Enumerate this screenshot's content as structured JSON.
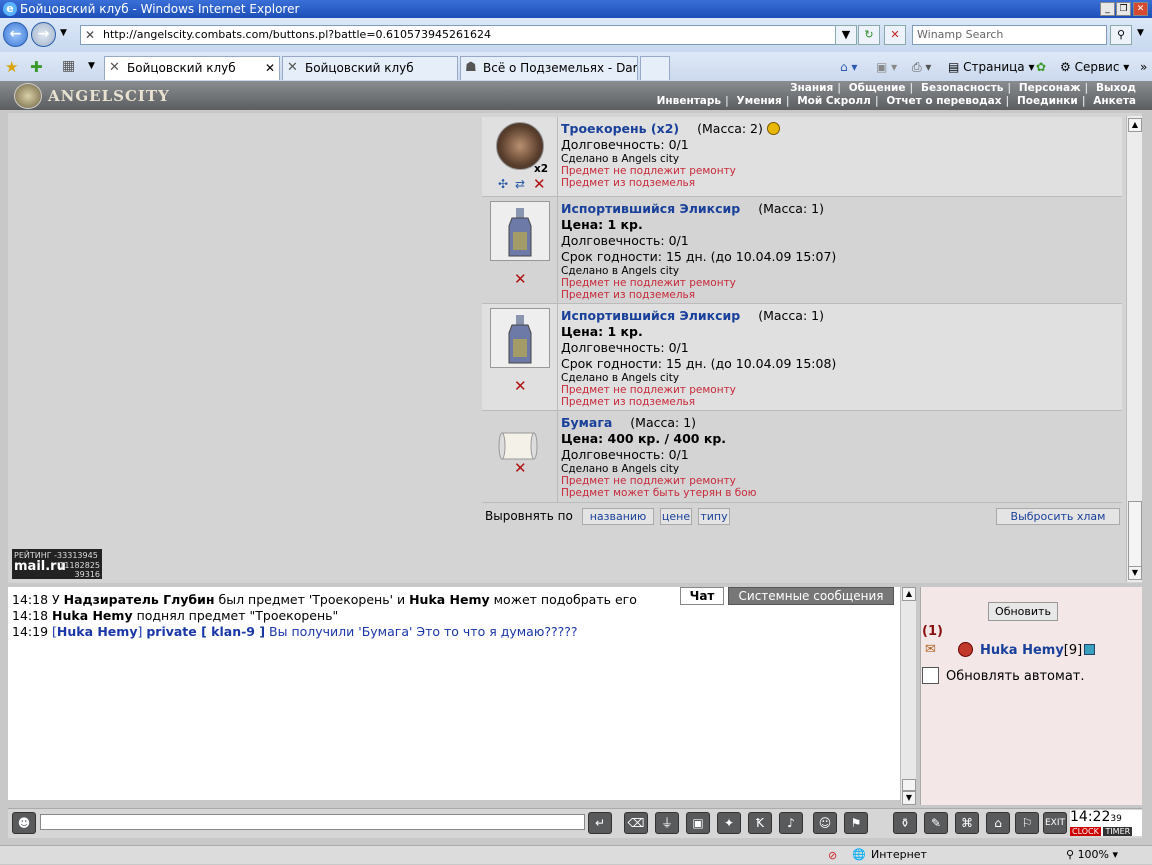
{
  "window": {
    "title": "Бойцовский клуб - Windows Internet Explorer"
  },
  "address": {
    "url": "http://angelscity.combats.com/buttons.pl?battle=0.610573945261624",
    "search_placeholder": "Winamp Search"
  },
  "tabs": [
    {
      "label": "Бойцовский клуб",
      "active": true
    },
    {
      "label": "Бойцовский клуб",
      "active": false
    },
    {
      "label": "Всё о Подземельях - DarkCl...",
      "active": false
    }
  ],
  "browser_tools": {
    "page": "Страница",
    "service": "Сервис"
  },
  "game": {
    "logo": "ANGELSCITY",
    "menu_top": [
      "Знания",
      "Общение",
      "Безопасность",
      "Персонаж",
      "Выход"
    ],
    "menu_bottom": [
      "Инвентарь",
      "Умения",
      "Мой Скролл",
      "Отчет о переводах",
      "Поединки",
      "Анкета"
    ]
  },
  "items": [
    {
      "name": "Троекорень (x2)",
      "mass": "(Масса: 2)",
      "lines": [
        "Долговечность: 0/1"
      ],
      "small": [
        "Сделано в Angels city"
      ],
      "red": [
        "Предмет не подлежит ремонту",
        "Предмет из подземелья"
      ],
      "count_badge": "x2"
    },
    {
      "name": "Испортившийся Эликсир",
      "mass": "(Масса: 1)",
      "price": "Цена: 1 кр.",
      "lines": [
        "Долговечность: 0/1",
        "Срок годности: 15 дн. (до 10.04.09 15:07)"
      ],
      "small": [
        "Сделано в Angels city"
      ],
      "red": [
        "Предмет не подлежит ремонту",
        "Предмет из подземелья"
      ]
    },
    {
      "name": "Испортившийся Эликсир",
      "mass": "(Масса: 1)",
      "price": "Цена: 1 кр.",
      "lines": [
        "Долговечность: 0/1",
        "Срок годности: 15 дн. (до 10.04.09 15:08)"
      ],
      "small": [
        "Сделано в Angels city"
      ],
      "red": [
        "Предмет не подлежит ремонту",
        "Предмет из подземелья"
      ]
    },
    {
      "name": "Бумага",
      "mass": "(Масса: 1)",
      "price": "Цена: 400 кр. / 400 кр.",
      "lines": [
        "Долговечность: 0/1"
      ],
      "small": [
        "Сделано в Angels city"
      ],
      "red": [
        "Предмет не подлежит ремонту",
        "Предмет может быть утерян в бою"
      ]
    }
  ],
  "sort": {
    "label": "Выровнять по",
    "by_name": "названию",
    "by_price": "цене",
    "by_type": "типу",
    "drop_junk": "Выбросить хлам"
  },
  "rating": {
    "line1": "РЕЙТИНГ -33313945",
    "logo": "mail.ru",
    "n1": "11182825",
    "n2": "39316"
  },
  "chat": {
    "tabs": {
      "chat": "Чат",
      "system": "Системные сообщения"
    },
    "lines": [
      {
        "time": "14:18",
        "text_a": "У ",
        "name_a": "Надзиратель Глубин",
        "text_b": " был предмет 'Троекорень' и ",
        "name_b": "Huka Hemy",
        "text_c": " может подобрать его"
      },
      {
        "time": "14:18",
        "name_a": "Huka Hemy",
        "text_b": " поднял предмет \"Троекорень\""
      },
      {
        "time": "14:19",
        "who": "Huka Hemy",
        "private": "private [ klan-9 ]",
        "msg": " Вы получили 'Бумага' Это то что я думаю?????"
      }
    ]
  },
  "side": {
    "refresh": "Обновить",
    "count": "(1)",
    "user": "Huka Hemy",
    "level": "[9]",
    "auto_refresh": "Обновлять автомат."
  },
  "clock": {
    "time": "14:22",
    "sec": "39",
    "l1": "CLOCK",
    "l2": "TIMER"
  },
  "status": {
    "zone": "Интернет",
    "zoom": "100%"
  }
}
